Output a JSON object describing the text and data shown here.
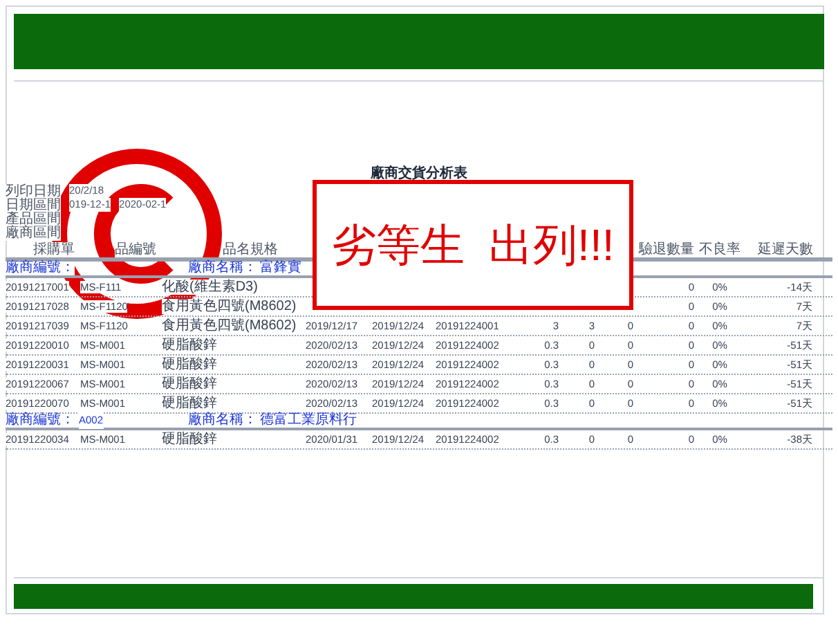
{
  "report": {
    "title": "廠商交貨分析表",
    "info": [
      {
        "label": "列印日期",
        "values": [
          "20/2/18"
        ]
      },
      {
        "label": "日期區間",
        "values": [
          "019-12-1",
          "2020-02-1"
        ]
      },
      {
        "label": "產品區間"
      },
      {
        "label": "廠商區間"
      }
    ],
    "columns": [
      "採購單",
      "品編號",
      "品名規格",
      null,
      null,
      null,
      null,
      null,
      null,
      "驗退數量",
      "不良率",
      "延遲天數"
    ],
    "groups": [
      {
        "vendor_id_label": "廠商編號：",
        "vendor_name_label": "廠商名稱：",
        "vendor_name": "富鋒實",
        "rows": [
          {
            "cells": [
              "20191217001",
              "MS-F111",
              "化酸(維生素D3)",
              null,
              null,
              null,
              null,
              null,
              null,
              "0",
              "0%",
              "-14天"
            ]
          },
          {
            "cells": [
              "20191217028",
              "MS-F1120",
              "食用黃色四號(M8602)",
              null,
              null,
              null,
              null,
              null,
              null,
              "0",
              "0%",
              "7天"
            ]
          },
          {
            "cells": [
              "20191217039",
              "MS-F1120",
              "食用黃色四號(M8602)",
              "2019/12/17",
              "2019/12/24",
              "20191224001",
              "3",
              "3",
              "0",
              "0",
              "0%",
              "7天"
            ]
          },
          {
            "cells": [
              "20191220010",
              "MS-M001",
              "硬脂酸鋅",
              "2020/02/13",
              "2019/12/24",
              "20191224002",
              "0.3",
              "0",
              "0",
              "0",
              "0%",
              "-51天"
            ]
          },
          {
            "cells": [
              "20191220031",
              "MS-M001",
              "硬脂酸鋅",
              "2020/02/13",
              "2019/12/24",
              "20191224002",
              "0.3",
              "0",
              "0",
              "0",
              "0%",
              "-51天"
            ]
          },
          {
            "cells": [
              "20191220067",
              "MS-M001",
              "硬脂酸鋅",
              "2020/02/13",
              "2019/12/24",
              "20191224002",
              "0.3",
              "0",
              "0",
              "0",
              "0%",
              "-51天"
            ]
          },
          {
            "cells": [
              "20191220070",
              "MS-M001",
              "硬脂酸鋅",
              "2020/02/13",
              "2019/12/24",
              "20191224002",
              "0.3",
              "0",
              "0",
              "0",
              "0%",
              "-51天"
            ]
          }
        ]
      },
      {
        "vendor_id_label": "廠商編號：",
        "vendor_id": "A002",
        "vendor_name_label": "廠商名稱：",
        "vendor_name": "德富工業原料行",
        "rows": [
          {
            "cells": [
              "20191220034",
              "MS-M001",
              "硬脂酸鋅",
              "2020/01/31",
              "2019/12/24",
              "20191224002",
              "0.3",
              "0",
              "0",
              "0",
              "0%",
              "-38天"
            ]
          }
        ]
      }
    ]
  },
  "stamp": {
    "text": "劣等生  出列!!!"
  }
}
